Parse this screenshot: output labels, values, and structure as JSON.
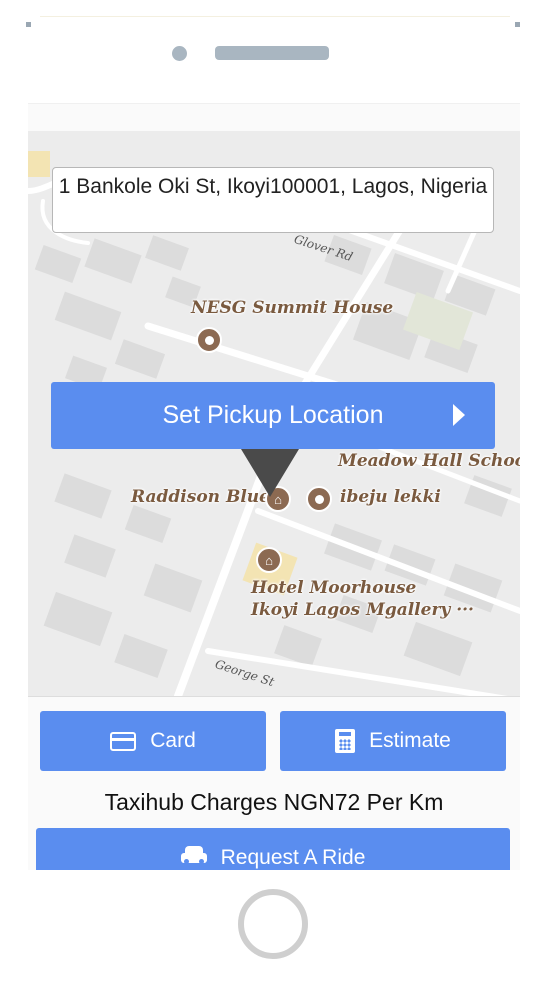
{
  "map": {
    "address": "1 Bankole Oki St, Ikoyi100001, Lagos, Nigeria",
    "streets": [
      "Glover Rd",
      "George St"
    ],
    "pois": [
      {
        "name": "NESG Summit House",
        "icon": "place-icon"
      },
      {
        "name": "Meadow Hall Schoo",
        "icon": "school-icon"
      },
      {
        "name": "Raddison Blue",
        "icon": "hotel-icon"
      },
      {
        "name": "ibeju lekki",
        "icon": "place-icon"
      },
      {
        "name": "Hotel Moorhouse",
        "icon": "hotel-icon"
      },
      {
        "name": "Ikoyi Lagos Mgallery ···",
        "icon": "hotel-icon"
      }
    ]
  },
  "pickup": {
    "label": "Set Pickup Location",
    "icon": "play-arrow-icon"
  },
  "actions": {
    "card": {
      "label": "Card",
      "icon": "credit-card-icon"
    },
    "estimate": {
      "label": "Estimate",
      "icon": "calculator-icon"
    }
  },
  "charges_text": "Taxihub Charges NGN72 Per Km",
  "request": {
    "label": "Request A Ride",
    "icon": "car-icon"
  },
  "colors": {
    "accent": "#5a8def",
    "poi": "#8c6a52",
    "map_bg": "#ececec"
  }
}
